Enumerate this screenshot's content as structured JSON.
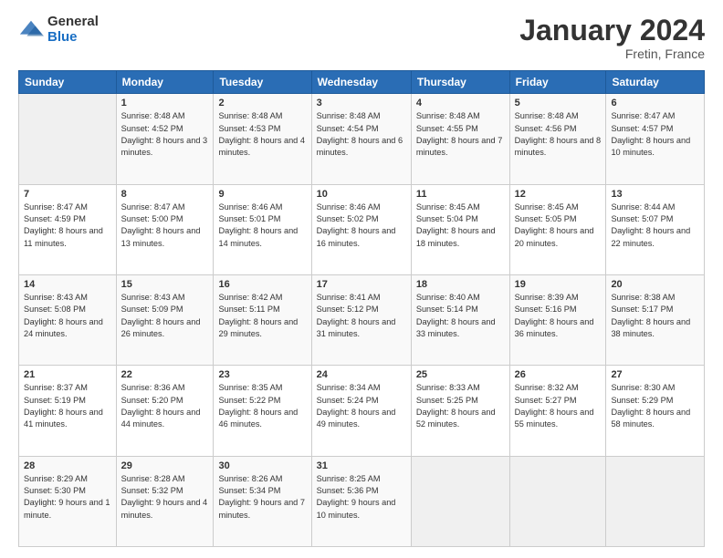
{
  "logo": {
    "general": "General",
    "blue": "Blue"
  },
  "title": "January 2024",
  "location": "Fretin, France",
  "header_days": [
    "Sunday",
    "Monday",
    "Tuesday",
    "Wednesday",
    "Thursday",
    "Friday",
    "Saturday"
  ],
  "weeks": [
    [
      {
        "day": "",
        "sunrise": "",
        "sunset": "",
        "daylight": ""
      },
      {
        "day": "1",
        "sunrise": "Sunrise: 8:48 AM",
        "sunset": "Sunset: 4:52 PM",
        "daylight": "Daylight: 8 hours and 3 minutes."
      },
      {
        "day": "2",
        "sunrise": "Sunrise: 8:48 AM",
        "sunset": "Sunset: 4:53 PM",
        "daylight": "Daylight: 8 hours and 4 minutes."
      },
      {
        "day": "3",
        "sunrise": "Sunrise: 8:48 AM",
        "sunset": "Sunset: 4:54 PM",
        "daylight": "Daylight: 8 hours and 6 minutes."
      },
      {
        "day": "4",
        "sunrise": "Sunrise: 8:48 AM",
        "sunset": "Sunset: 4:55 PM",
        "daylight": "Daylight: 8 hours and 7 minutes."
      },
      {
        "day": "5",
        "sunrise": "Sunrise: 8:48 AM",
        "sunset": "Sunset: 4:56 PM",
        "daylight": "Daylight: 8 hours and 8 minutes."
      },
      {
        "day": "6",
        "sunrise": "Sunrise: 8:47 AM",
        "sunset": "Sunset: 4:57 PM",
        "daylight": "Daylight: 8 hours and 10 minutes."
      }
    ],
    [
      {
        "day": "7",
        "sunrise": "Sunrise: 8:47 AM",
        "sunset": "Sunset: 4:59 PM",
        "daylight": "Daylight: 8 hours and 11 minutes."
      },
      {
        "day": "8",
        "sunrise": "Sunrise: 8:47 AM",
        "sunset": "Sunset: 5:00 PM",
        "daylight": "Daylight: 8 hours and 13 minutes."
      },
      {
        "day": "9",
        "sunrise": "Sunrise: 8:46 AM",
        "sunset": "Sunset: 5:01 PM",
        "daylight": "Daylight: 8 hours and 14 minutes."
      },
      {
        "day": "10",
        "sunrise": "Sunrise: 8:46 AM",
        "sunset": "Sunset: 5:02 PM",
        "daylight": "Daylight: 8 hours and 16 minutes."
      },
      {
        "day": "11",
        "sunrise": "Sunrise: 8:45 AM",
        "sunset": "Sunset: 5:04 PM",
        "daylight": "Daylight: 8 hours and 18 minutes."
      },
      {
        "day": "12",
        "sunrise": "Sunrise: 8:45 AM",
        "sunset": "Sunset: 5:05 PM",
        "daylight": "Daylight: 8 hours and 20 minutes."
      },
      {
        "day": "13",
        "sunrise": "Sunrise: 8:44 AM",
        "sunset": "Sunset: 5:07 PM",
        "daylight": "Daylight: 8 hours and 22 minutes."
      }
    ],
    [
      {
        "day": "14",
        "sunrise": "Sunrise: 8:43 AM",
        "sunset": "Sunset: 5:08 PM",
        "daylight": "Daylight: 8 hours and 24 minutes."
      },
      {
        "day": "15",
        "sunrise": "Sunrise: 8:43 AM",
        "sunset": "Sunset: 5:09 PM",
        "daylight": "Daylight: 8 hours and 26 minutes."
      },
      {
        "day": "16",
        "sunrise": "Sunrise: 8:42 AM",
        "sunset": "Sunset: 5:11 PM",
        "daylight": "Daylight: 8 hours and 29 minutes."
      },
      {
        "day": "17",
        "sunrise": "Sunrise: 8:41 AM",
        "sunset": "Sunset: 5:12 PM",
        "daylight": "Daylight: 8 hours and 31 minutes."
      },
      {
        "day": "18",
        "sunrise": "Sunrise: 8:40 AM",
        "sunset": "Sunset: 5:14 PM",
        "daylight": "Daylight: 8 hours and 33 minutes."
      },
      {
        "day": "19",
        "sunrise": "Sunrise: 8:39 AM",
        "sunset": "Sunset: 5:16 PM",
        "daylight": "Daylight: 8 hours and 36 minutes."
      },
      {
        "day": "20",
        "sunrise": "Sunrise: 8:38 AM",
        "sunset": "Sunset: 5:17 PM",
        "daylight": "Daylight: 8 hours and 38 minutes."
      }
    ],
    [
      {
        "day": "21",
        "sunrise": "Sunrise: 8:37 AM",
        "sunset": "Sunset: 5:19 PM",
        "daylight": "Daylight: 8 hours and 41 minutes."
      },
      {
        "day": "22",
        "sunrise": "Sunrise: 8:36 AM",
        "sunset": "Sunset: 5:20 PM",
        "daylight": "Daylight: 8 hours and 44 minutes."
      },
      {
        "day": "23",
        "sunrise": "Sunrise: 8:35 AM",
        "sunset": "Sunset: 5:22 PM",
        "daylight": "Daylight: 8 hours and 46 minutes."
      },
      {
        "day": "24",
        "sunrise": "Sunrise: 8:34 AM",
        "sunset": "Sunset: 5:24 PM",
        "daylight": "Daylight: 8 hours and 49 minutes."
      },
      {
        "day": "25",
        "sunrise": "Sunrise: 8:33 AM",
        "sunset": "Sunset: 5:25 PM",
        "daylight": "Daylight: 8 hours and 52 minutes."
      },
      {
        "day": "26",
        "sunrise": "Sunrise: 8:32 AM",
        "sunset": "Sunset: 5:27 PM",
        "daylight": "Daylight: 8 hours and 55 minutes."
      },
      {
        "day": "27",
        "sunrise": "Sunrise: 8:30 AM",
        "sunset": "Sunset: 5:29 PM",
        "daylight": "Daylight: 8 hours and 58 minutes."
      }
    ],
    [
      {
        "day": "28",
        "sunrise": "Sunrise: 8:29 AM",
        "sunset": "Sunset: 5:30 PM",
        "daylight": "Daylight: 9 hours and 1 minute."
      },
      {
        "day": "29",
        "sunrise": "Sunrise: 8:28 AM",
        "sunset": "Sunset: 5:32 PM",
        "daylight": "Daylight: 9 hours and 4 minutes."
      },
      {
        "day": "30",
        "sunrise": "Sunrise: 8:26 AM",
        "sunset": "Sunset: 5:34 PM",
        "daylight": "Daylight: 9 hours and 7 minutes."
      },
      {
        "day": "31",
        "sunrise": "Sunrise: 8:25 AM",
        "sunset": "Sunset: 5:36 PM",
        "daylight": "Daylight: 9 hours and 10 minutes."
      },
      {
        "day": "",
        "sunrise": "",
        "sunset": "",
        "daylight": ""
      },
      {
        "day": "",
        "sunrise": "",
        "sunset": "",
        "daylight": ""
      },
      {
        "day": "",
        "sunrise": "",
        "sunset": "",
        "daylight": ""
      }
    ]
  ]
}
